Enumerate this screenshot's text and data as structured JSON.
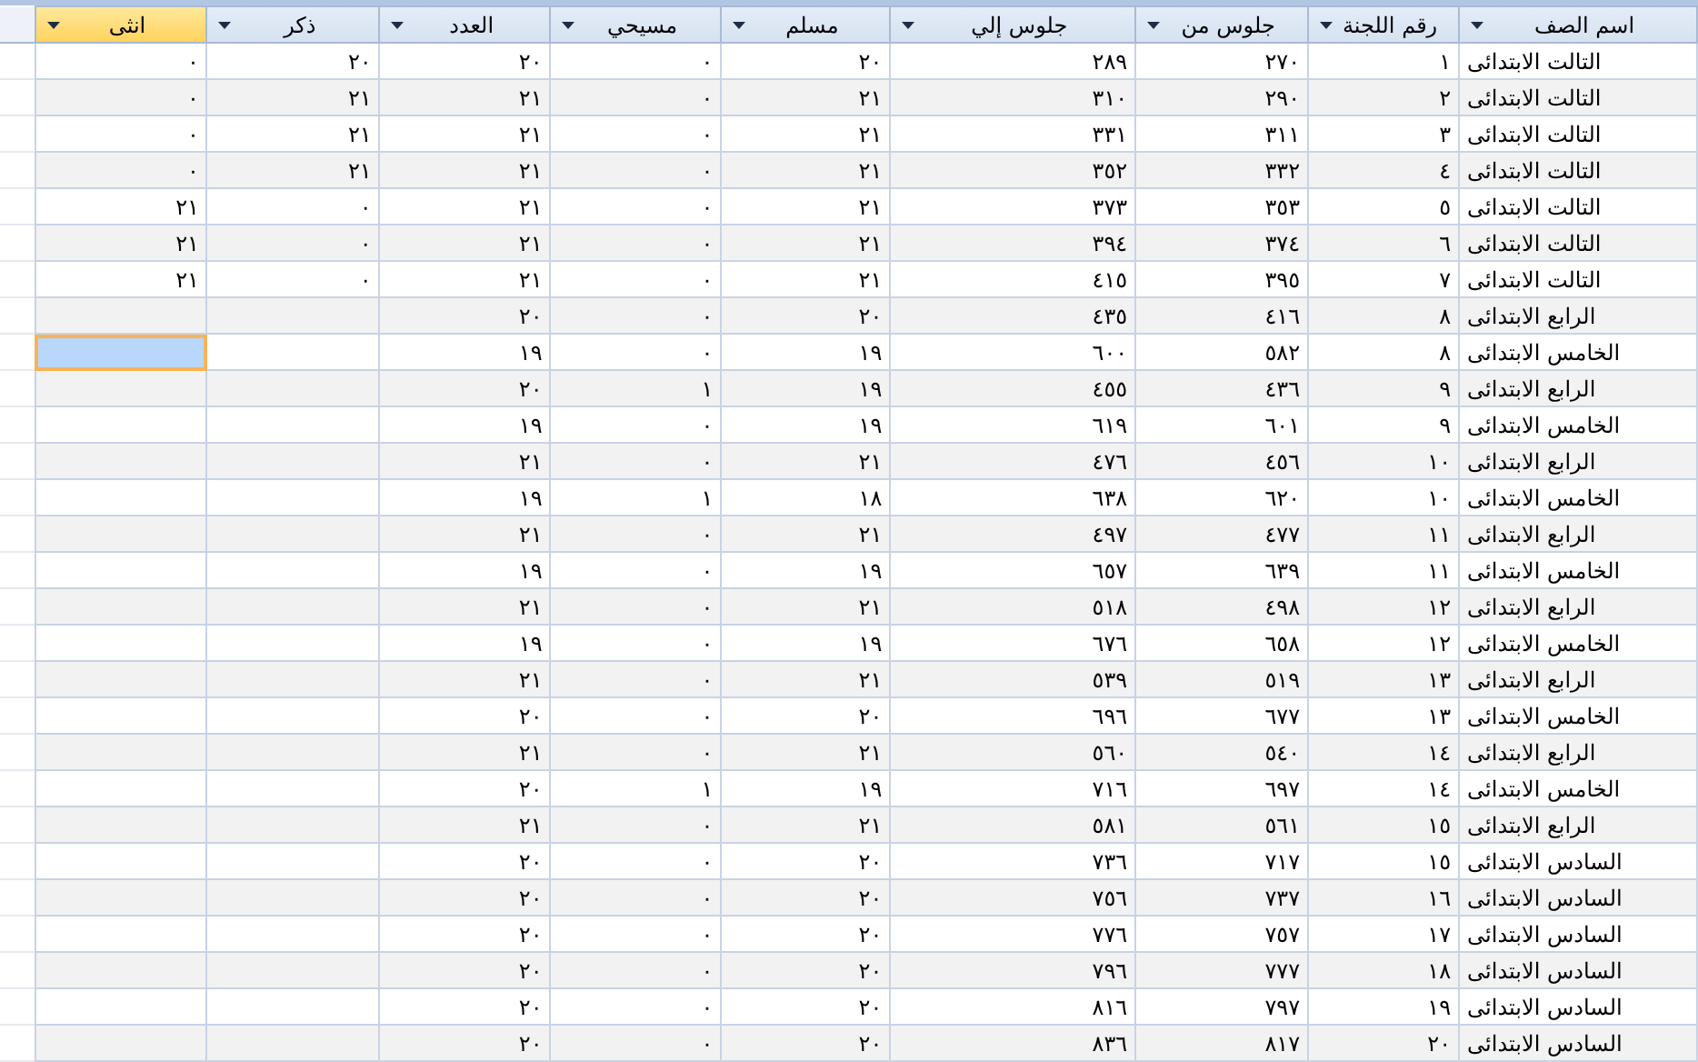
{
  "columns": [
    {
      "label": "اسم الصف",
      "selected": false
    },
    {
      "label": "رقم اللجنة",
      "selected": false
    },
    {
      "label": "جلوس من",
      "selected": false
    },
    {
      "label": "جلوس إلي",
      "selected": false
    },
    {
      "label": "مسلم",
      "selected": false
    },
    {
      "label": "مسيحي",
      "selected": false
    },
    {
      "label": "العدد",
      "selected": false
    },
    {
      "label": "ذكر",
      "selected": false
    },
    {
      "label": "انثى",
      "selected": true
    }
  ],
  "rows": [
    {
      "selected": false,
      "cells": [
        "التالت الابتدائى",
        "١",
        "٢٧٠",
        "٢٨٩",
        "٢٠",
        "٠",
        "٢٠",
        "٢٠",
        "٠"
      ]
    },
    {
      "selected": false,
      "cells": [
        "التالت الابتدائى",
        "٢",
        "٢٩٠",
        "٣١٠",
        "٢١",
        "٠",
        "٢١",
        "٢١",
        "٠"
      ]
    },
    {
      "selected": false,
      "cells": [
        "التالت الابتدائى",
        "٣",
        "٣١١",
        "٣٣١",
        "٢١",
        "٠",
        "٢١",
        "٢١",
        "٠"
      ]
    },
    {
      "selected": false,
      "cells": [
        "التالت الابتدائى",
        "٤",
        "٣٣٢",
        "٣٥٢",
        "٢١",
        "٠",
        "٢١",
        "٢١",
        "٠"
      ]
    },
    {
      "selected": false,
      "cells": [
        "التالت الابتدائى",
        "٥",
        "٣٥٣",
        "٣٧٣",
        "٢١",
        "٠",
        "٢١",
        "٠",
        "٢١"
      ]
    },
    {
      "selected": false,
      "cells": [
        "التالت الابتدائى",
        "٦",
        "٣٧٤",
        "٣٩٤",
        "٢١",
        "٠",
        "٢١",
        "٠",
        "٢١"
      ]
    },
    {
      "selected": false,
      "cells": [
        "التالت الابتدائى",
        "٧",
        "٣٩٥",
        "٤١٥",
        "٢١",
        "٠",
        "٢١",
        "٠",
        "٢١"
      ]
    },
    {
      "selected": false,
      "cells": [
        "الرابع الابتدائى",
        "٨",
        "٤١٦",
        "٤٣٥",
        "٢٠",
        "٠",
        "٢٠"
      ]
    },
    {
      "selected": true,
      "cells": [
        "الخامس الابتدائى",
        "٨",
        "٥٨٢",
        "٦٠٠",
        "١٩",
        "٠",
        "١٩"
      ]
    },
    {
      "selected": false,
      "cells": [
        "الرابع الابتدائى",
        "٩",
        "٤٣٦",
        "٤٥٥",
        "١٩",
        "١",
        "٢٠"
      ]
    },
    {
      "selected": false,
      "cells": [
        "الخامس الابتدائى",
        "٩",
        "٦٠١",
        "٦١٩",
        "١٩",
        "٠",
        "١٩"
      ]
    },
    {
      "selected": false,
      "cells": [
        "الرابع الابتدائى",
        "١٠",
        "٤٥٦",
        "٤٧٦",
        "٢١",
        "٠",
        "٢١"
      ]
    },
    {
      "selected": false,
      "cells": [
        "الخامس الابتدائى",
        "١٠",
        "٦٢٠",
        "٦٣٨",
        "١٨",
        "١",
        "١٩"
      ]
    },
    {
      "selected": false,
      "cells": [
        "الرابع الابتدائى",
        "١١",
        "٤٧٧",
        "٤٩٧",
        "٢١",
        "٠",
        "٢١"
      ]
    },
    {
      "selected": false,
      "cells": [
        "الخامس الابتدائى",
        "١١",
        "٦٣٩",
        "٦٥٧",
        "١٩",
        "٠",
        "١٩"
      ]
    },
    {
      "selected": false,
      "cells": [
        "الرابع الابتدائى",
        "١٢",
        "٤٩٨",
        "٥١٨",
        "٢١",
        "٠",
        "٢١"
      ]
    },
    {
      "selected": false,
      "cells": [
        "الخامس الابتدائى",
        "١٢",
        "٦٥٨",
        "٦٧٦",
        "١٩",
        "٠",
        "١٩"
      ]
    },
    {
      "selected": false,
      "cells": [
        "الرابع الابتدائى",
        "١٣",
        "٥١٩",
        "٥٣٩",
        "٢١",
        "٠",
        "٢١"
      ]
    },
    {
      "selected": false,
      "cells": [
        "الخامس الابتدائى",
        "١٣",
        "٦٧٧",
        "٦٩٦",
        "٢٠",
        "٠",
        "٢٠"
      ]
    },
    {
      "selected": false,
      "cells": [
        "الرابع الابتدائى",
        "١٤",
        "٥٤٠",
        "٥٦٠",
        "٢١",
        "٠",
        "٢١"
      ]
    },
    {
      "selected": false,
      "cells": [
        "الخامس الابتدائى",
        "١٤",
        "٦٩٧",
        "٧١٦",
        "١٩",
        "١",
        "٢٠"
      ]
    },
    {
      "selected": false,
      "cells": [
        "الرابع الابتدائى",
        "١٥",
        "٥٦١",
        "٥٨١",
        "٢١",
        "٠",
        "٢١"
      ]
    },
    {
      "selected": false,
      "cells": [
        "السادس الابتدائى",
        "١٥",
        "٧١٧",
        "٧٣٦",
        "٢٠",
        "٠",
        "٢٠"
      ]
    },
    {
      "selected": false,
      "cells": [
        "السادس الابتدائى",
        "١٦",
        "٧٣٧",
        "٧٥٦",
        "٢٠",
        "٠",
        "٢٠"
      ]
    },
    {
      "selected": false,
      "cells": [
        "السادس الابتدائى",
        "١٧",
        "٧٥٧",
        "٧٧٦",
        "٢٠",
        "٠",
        "٢٠"
      ]
    },
    {
      "selected": false,
      "cells": [
        "السادس الابتدائى",
        "١٨",
        "٧٧٧",
        "٧٩٦",
        "٢٠",
        "٠",
        "٢٠"
      ]
    },
    {
      "selected": false,
      "cells": [
        "السادس الابتدائى",
        "١٩",
        "٧٩٧",
        "٨١٦",
        "٢٠",
        "٠",
        "٢٠"
      ]
    },
    {
      "selected": false,
      "cells": [
        "السادس الابتدائى",
        "٢٠",
        "٨١٧",
        "٨٣٦",
        "٢٠",
        "٠",
        "٢٠"
      ]
    }
  ]
}
